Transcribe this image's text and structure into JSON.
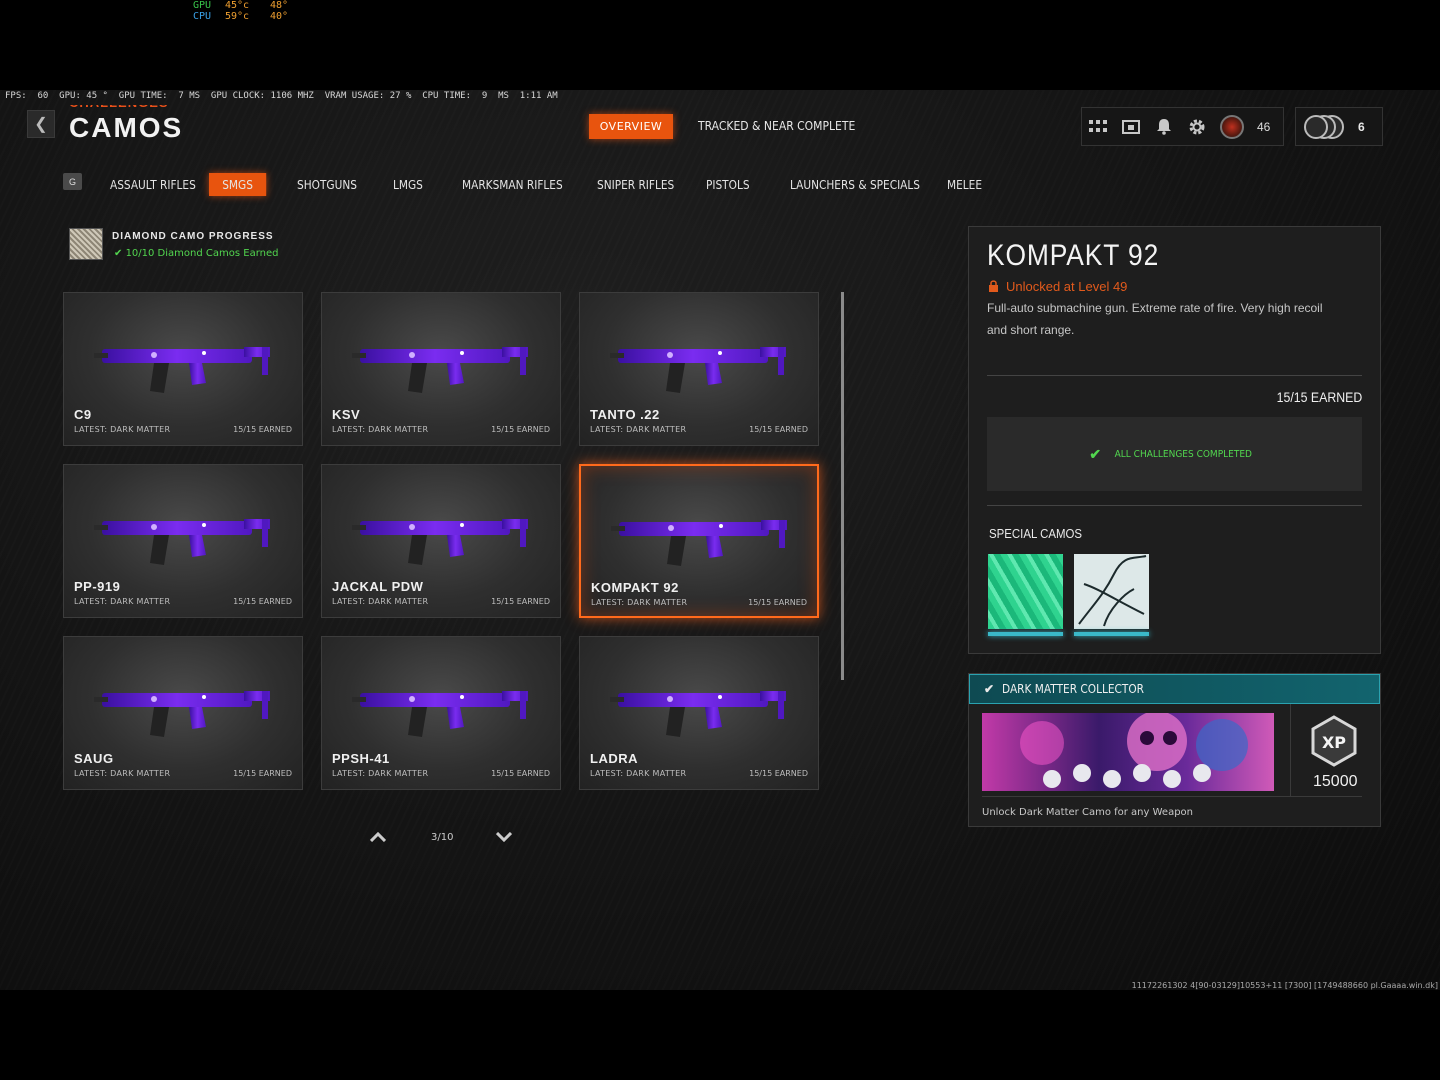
{
  "overlay": {
    "gpu_label": "GPU",
    "gpu_temp": "45°c",
    "gpu_val2": "48°",
    "cpu_label": "CPU",
    "cpu_temp": "59°c",
    "cpu_val2": "40°",
    "perf_line": "FPS:  60  GPU: 45 °  GPU TIME:  7 MS  GPU CLOCK: 1106 MHZ  VRAM USAGE: 27 %  CPU TIME:  9  MS  1:11 AM"
  },
  "header": {
    "breadcrumb": "CHALLENGES",
    "title": "CAMOS",
    "tabs": {
      "overview": "OVERVIEW",
      "tracked": "TRACKED & NEAR COMPLETE"
    },
    "player_level": "46",
    "prestige": "6"
  },
  "categories": {
    "key_hint": "G",
    "items": [
      "ASSAULT RIFLES",
      "SMGS",
      "SHOTGUNS",
      "LMGS",
      "MARKSMAN RIFLES",
      "SNIPER RIFLES",
      "PISTOLS",
      "LAUNCHERS & SPECIALS",
      "MELEE"
    ],
    "active": "SMGS"
  },
  "diamond_progress": {
    "title": "DIAMOND CAMO PROGRESS",
    "status": "10/10 Diamond Camos Earned"
  },
  "weapons": [
    {
      "name": "C9",
      "latest": "LATEST: DARK MATTER",
      "earned": "15/15 EARNED"
    },
    {
      "name": "KSV",
      "latest": "LATEST: DARK MATTER",
      "earned": "15/15 EARNED"
    },
    {
      "name": "TANTO .22",
      "latest": "LATEST: DARK MATTER",
      "earned": "15/15 EARNED"
    },
    {
      "name": "PP-919",
      "latest": "LATEST: DARK MATTER",
      "earned": "15/15 EARNED"
    },
    {
      "name": "JACKAL PDW",
      "latest": "LATEST: DARK MATTER",
      "earned": "15/15 EARNED"
    },
    {
      "name": "KOMPAKT 92",
      "latest": "LATEST: DARK MATTER",
      "earned": "15/15 EARNED",
      "selected": true
    },
    {
      "name": "SAUG",
      "latest": "LATEST: DARK MATTER",
      "earned": "15/15 EARNED"
    },
    {
      "name": "PPSH-41",
      "latest": "LATEST: DARK MATTER",
      "earned": "15/15 EARNED"
    },
    {
      "name": "LADRA",
      "latest": "LATEST: DARK MATTER",
      "earned": "15/15 EARNED"
    }
  ],
  "pagination": {
    "label": "3/10"
  },
  "detail": {
    "name": "KOMPAKT 92",
    "unlock": "Unlocked at Level 49",
    "description": "Full-auto submachine gun.  Extreme rate of fire. Very high recoil and short range.",
    "earned": "15/15 EARNED",
    "challenges_status": "ALL CHALLENGES COMPLETED",
    "special_camos_title": "SPECIAL CAMOS"
  },
  "reward": {
    "title": "DARK MATTER COLLECTOR",
    "xp": "15000",
    "xp_badge": "XP",
    "description": "Unlock Dark Matter Camo for any Weapon"
  },
  "build_string": "11172261302 4[90-03129]10553+11 [7300] [1749488660 pl.Gaaaa.win.dk]",
  "colors": {
    "accent": "#e8540e",
    "success": "#52d64f",
    "teal": "#12646e",
    "camo_purple": "#7a2cf0"
  }
}
